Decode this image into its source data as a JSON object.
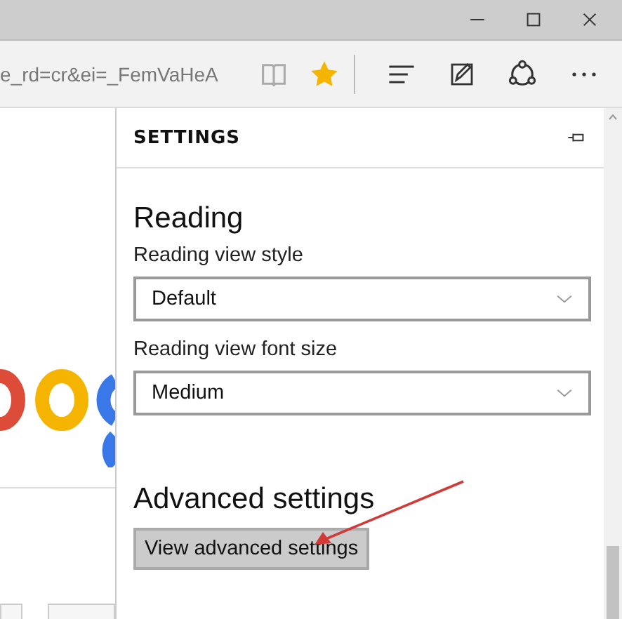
{
  "address_bar": {
    "url": "e_rd=cr&ei=_FemVaHeA"
  },
  "settings_panel": {
    "title": "SETTINGS",
    "sections": [
      {
        "heading": "Reading",
        "fields": [
          {
            "label": "Reading view style",
            "value": "Default"
          },
          {
            "label": "Reading view font size",
            "value": "Medium"
          }
        ]
      }
    ],
    "advanced": {
      "heading": "Advanced settings",
      "button": "View advanced settings"
    }
  }
}
